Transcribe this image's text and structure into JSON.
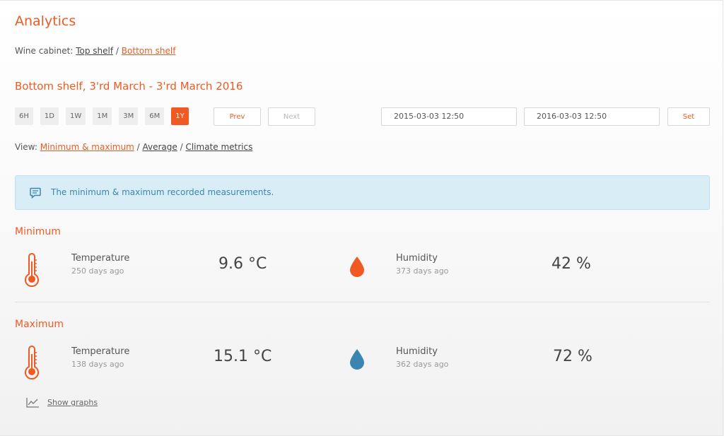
{
  "page": {
    "title": "Analytics"
  },
  "breadcrumb": {
    "prefix": "Wine cabinet:",
    "items": [
      "Top shelf",
      "Bottom shelf"
    ],
    "separator": "/"
  },
  "subtitle": "Bottom shelf, 3'rd March - 3'rd March 2016",
  "ranges": [
    "6H",
    "1D",
    "1W",
    "1M",
    "3M",
    "6M",
    "1Y"
  ],
  "active_range": "1Y",
  "nav": {
    "prev": "Prev",
    "next": "Next"
  },
  "date_range": {
    "from": "2015-03-03 12:50",
    "to": "2016-03-03 12:50",
    "set_label": "Set"
  },
  "view": {
    "prefix": "View:",
    "options": [
      "Minimum & maximum",
      "Average",
      "Climate metrics"
    ],
    "active": "Minimum & maximum",
    "separator": "/"
  },
  "info": {
    "icon": "comment-icon",
    "text": "The minimum & maximum recorded measurements."
  },
  "sections": {
    "minimum": {
      "title": "Minimum",
      "temperature": {
        "label": "Temperature",
        "ago": "250 days ago",
        "value": "9.6 °C"
      },
      "humidity": {
        "label": "Humidity",
        "ago": "373 days ago",
        "value": "42 %"
      }
    },
    "maximum": {
      "title": "Maximum",
      "temperature": {
        "label": "Temperature",
        "ago": "138 days ago",
        "value": "15.1 °C"
      },
      "humidity": {
        "label": "Humidity",
        "ago": "362 days ago",
        "value": "72 %"
      }
    }
  },
  "graph_link": "Show graphs",
  "colors": {
    "accent": "#f05a22",
    "info_bg": "#d9edf7",
    "info_text": "#3a87ad",
    "drop_min": "#f05a22",
    "drop_max": "#3b86b0"
  },
  "icons": {
    "thermometer": "thermometer-icon",
    "drop": "water-drop-icon",
    "graph": "line-chart-icon"
  }
}
